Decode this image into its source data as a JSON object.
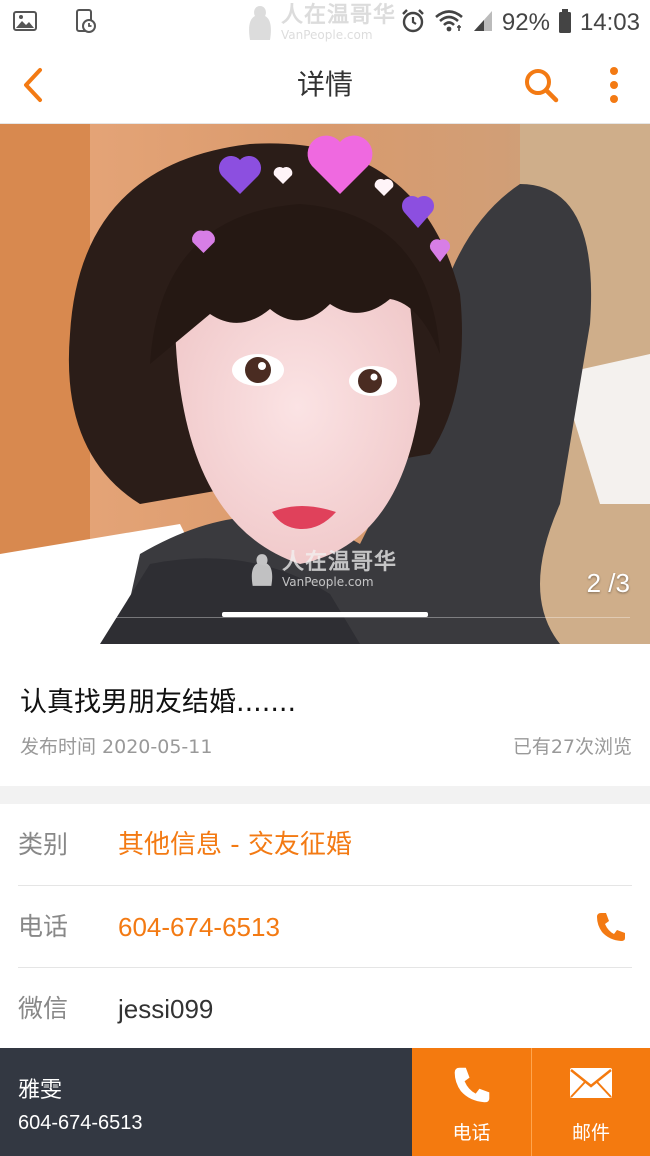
{
  "status_bar": {
    "battery_percent": "92%",
    "time": "14:03",
    "icons": [
      "gallery-icon",
      "screen-record-icon",
      "alarm-icon",
      "wifi-icon",
      "signal-icon",
      "battery-icon"
    ]
  },
  "watermark": {
    "title": "人在温哥华",
    "sub": "VanPeople.com"
  },
  "header": {
    "title": "详情",
    "icons": [
      "back-arrow-icon",
      "search-icon",
      "more-vertical-icon"
    ]
  },
  "photo": {
    "counter": "2 /3",
    "current": 2,
    "total": 3
  },
  "post": {
    "title": "认真找男朋友结婚.......",
    "date": "发布时间 2020-05-11",
    "views": "已有27次浏览"
  },
  "details": {
    "category_label": "类别",
    "category_value": "其他信息 - 交友征婚",
    "phone_label": "电话",
    "phone_value": "604-674-6513",
    "wechat_label": "微信",
    "wechat_value": "jessi099"
  },
  "contact": {
    "name": "雅雯",
    "phone": "604-674-6513",
    "call_label": "电话",
    "mail_label": "邮件"
  },
  "colors": {
    "accent": "#f37a13",
    "bottom_dark": "#333842",
    "button_orange": "#f47a0f"
  }
}
